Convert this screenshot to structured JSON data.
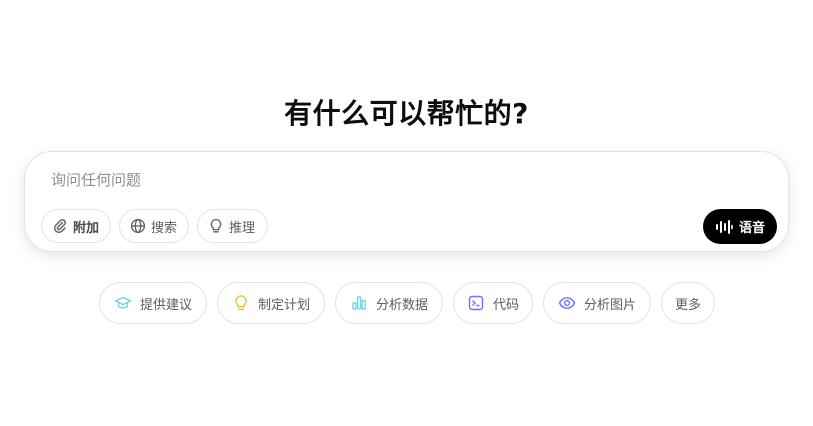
{
  "headline": "有什么可以帮忙的?",
  "composer": {
    "placeholder": "询问任何问题",
    "value": "",
    "tools": [
      {
        "label": "附加",
        "icon": "paperclip-icon"
      },
      {
        "label": "搜索",
        "icon": "globe-icon"
      },
      {
        "label": "推理",
        "icon": "lightbulb-icon"
      }
    ],
    "voice_label": "语音",
    "voice_icon": "waveform-icon"
  },
  "suggestions": [
    {
      "label": "提供建议",
      "icon": "graduation-cap-icon",
      "color": "#76d0eb"
    },
    {
      "label": "制定计划",
      "icon": "lightbulb-icon",
      "color": "#e2c541"
    },
    {
      "label": "分析数据",
      "icon": "bar-chart-icon",
      "color": "#76d0eb"
    },
    {
      "label": "代码",
      "icon": "terminal-icon",
      "color": "#6c71ff"
    },
    {
      "label": "分析图片",
      "icon": "eye-icon",
      "color": "#6c71ff"
    },
    {
      "label": "更多",
      "icon": "",
      "color": ""
    }
  ],
  "colors": {
    "background": "#ffffff",
    "border": "#e3e3e3",
    "voice_button": "#000000",
    "text_secondary": "#5d5d5d"
  }
}
